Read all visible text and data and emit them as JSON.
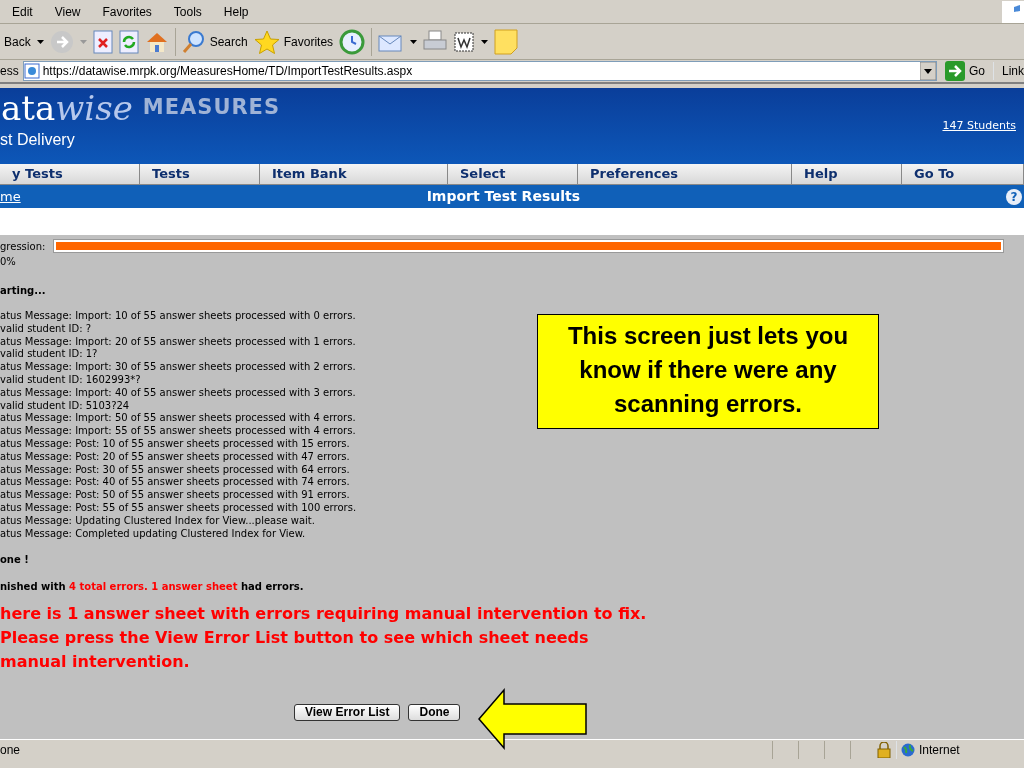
{
  "menu": [
    "Edit",
    "View",
    "Favorites",
    "Tools",
    "Help"
  ],
  "toolbar": {
    "back": "Back",
    "search": "Search",
    "favorites": "Favorites"
  },
  "address": {
    "label": "ess",
    "url": "https://datawise.mrpk.org/MeasuresHome/TD/ImportTestResults.aspx",
    "go": "Go",
    "links": "Link"
  },
  "banner": {
    "logo_a": "ata",
    "logo_b": "wise",
    "product": "MEASURES",
    "subtitle": "st Delivery",
    "students": "147 Students"
  },
  "nav": [
    {
      "label": "y Tests"
    },
    {
      "label": "Tests"
    },
    {
      "label": "Item Bank"
    },
    {
      "label": "Select"
    },
    {
      "label": "Preferences"
    },
    {
      "label": "Help"
    },
    {
      "label": "Go To"
    }
  ],
  "subbar": {
    "link": "me",
    "title": "Import Test Results",
    "help": "?"
  },
  "progress": {
    "label_1": "gression:",
    "label_2": "0%",
    "level": 1
  },
  "starting": "arting...",
  "log": [
    "atus Message: Import: 10 of 55 answer sheets processed with 0 errors.",
    "valid student ID: ?",
    "atus Message: Import: 20 of 55 answer sheets processed with 1 errors.",
    "valid student ID: 1?",
    "atus Message: Import: 30 of 55 answer sheets processed with 2 errors.",
    "valid student ID: 1602993*?",
    "atus Message: Import: 40 of 55 answer sheets processed with 3 errors.",
    "valid student ID: 5103?24",
    "atus Message: Import: 50 of 55 answer sheets processed with 4 errors.",
    "atus Message: Import: 55 of 55 answer sheets processed with 4 errors.",
    "atus Message: Post: 10 of 55 answer sheets processed with 15 errors.",
    "atus Message: Post: 20 of 55 answer sheets processed with 47 errors.",
    "atus Message: Post: 30 of 55 answer sheets processed with 64 errors.",
    "atus Message: Post: 40 of 55 answer sheets processed with 74 errors.",
    "atus Message: Post: 50 of 55 answer sheets processed with 91 errors.",
    "atus Message: Post: 55 of 55 answer sheets processed with 100 errors.",
    "atus Message: Updating Clustered Index for View...please wait.",
    "atus Message: Completed updating Clustered Index for View."
  ],
  "done": "one !",
  "summary": [
    {
      "kind": "normal",
      "text": "nished with "
    },
    {
      "kind": "error",
      "text": "4 total errors. 1 answer sheet"
    },
    {
      "kind": "normal",
      "text": " had errors."
    }
  ],
  "warning": [
    "here is 1 answer sheet with errors requiring manual intervention to fix.",
    "Please press the View Error List button to see which sheet needs",
    "manual intervention."
  ],
  "buttons": [
    "View Error List",
    "Done"
  ],
  "callout": "This screen just lets you know if there were any scanning errors.",
  "status_bar": {
    "text": "one",
    "zone": "Internet"
  }
}
